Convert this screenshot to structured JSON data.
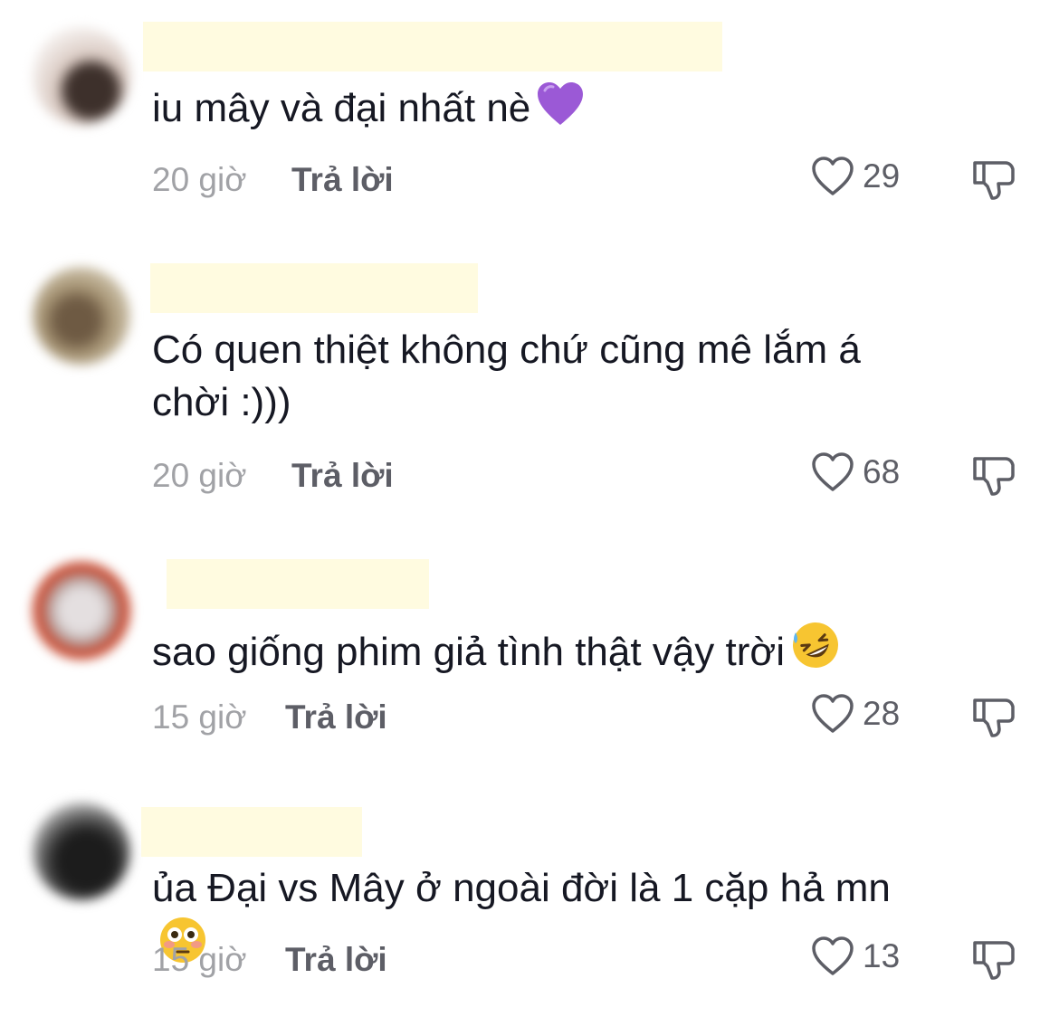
{
  "comments": [
    {
      "text": "iu mây và đại nhất nè",
      "emoji": "purple-heart",
      "time": "20 giờ",
      "reply_label": "Trả lời",
      "likes": "29",
      "avatar_colors": [
        "#e8dcd6",
        "#4a3f3a"
      ]
    },
    {
      "text": "Có quen thiệt không chứ cũng mê lắm á chời :)))",
      "emoji": "",
      "time": "20 giờ",
      "reply_label": "Trả lời",
      "likes": "68",
      "avatar_colors": [
        "#b7a88c",
        "#6e5a43"
      ]
    },
    {
      "text": "sao giống phim giả tình thật vậy trời",
      "emoji": "rolling-laughing-face",
      "time": "15 giờ",
      "reply_label": "Trả lời",
      "likes": "28",
      "avatar_colors": [
        "#d8d3d6",
        "#c4452e"
      ]
    },
    {
      "text": "ủa Đại vs Mây ở ngoài đời là 1 cặp hả mn",
      "emoji": "flushed-face",
      "time": "15 giờ",
      "reply_label": "Trả lời",
      "likes": "13",
      "avatar_colors": [
        "#cfcfcf",
        "#1c1c1c"
      ]
    }
  ],
  "icons": {
    "like": "heart-outline-icon",
    "dislike": "thumbs-down-outline-icon"
  },
  "colors": {
    "text": "#161823",
    "meta": "#a1a2a6",
    "action": "#5d5e66",
    "redaction": "#fffbe0",
    "purple_heart": "#9b59d6",
    "emoji_yellow": "#f7c531"
  }
}
